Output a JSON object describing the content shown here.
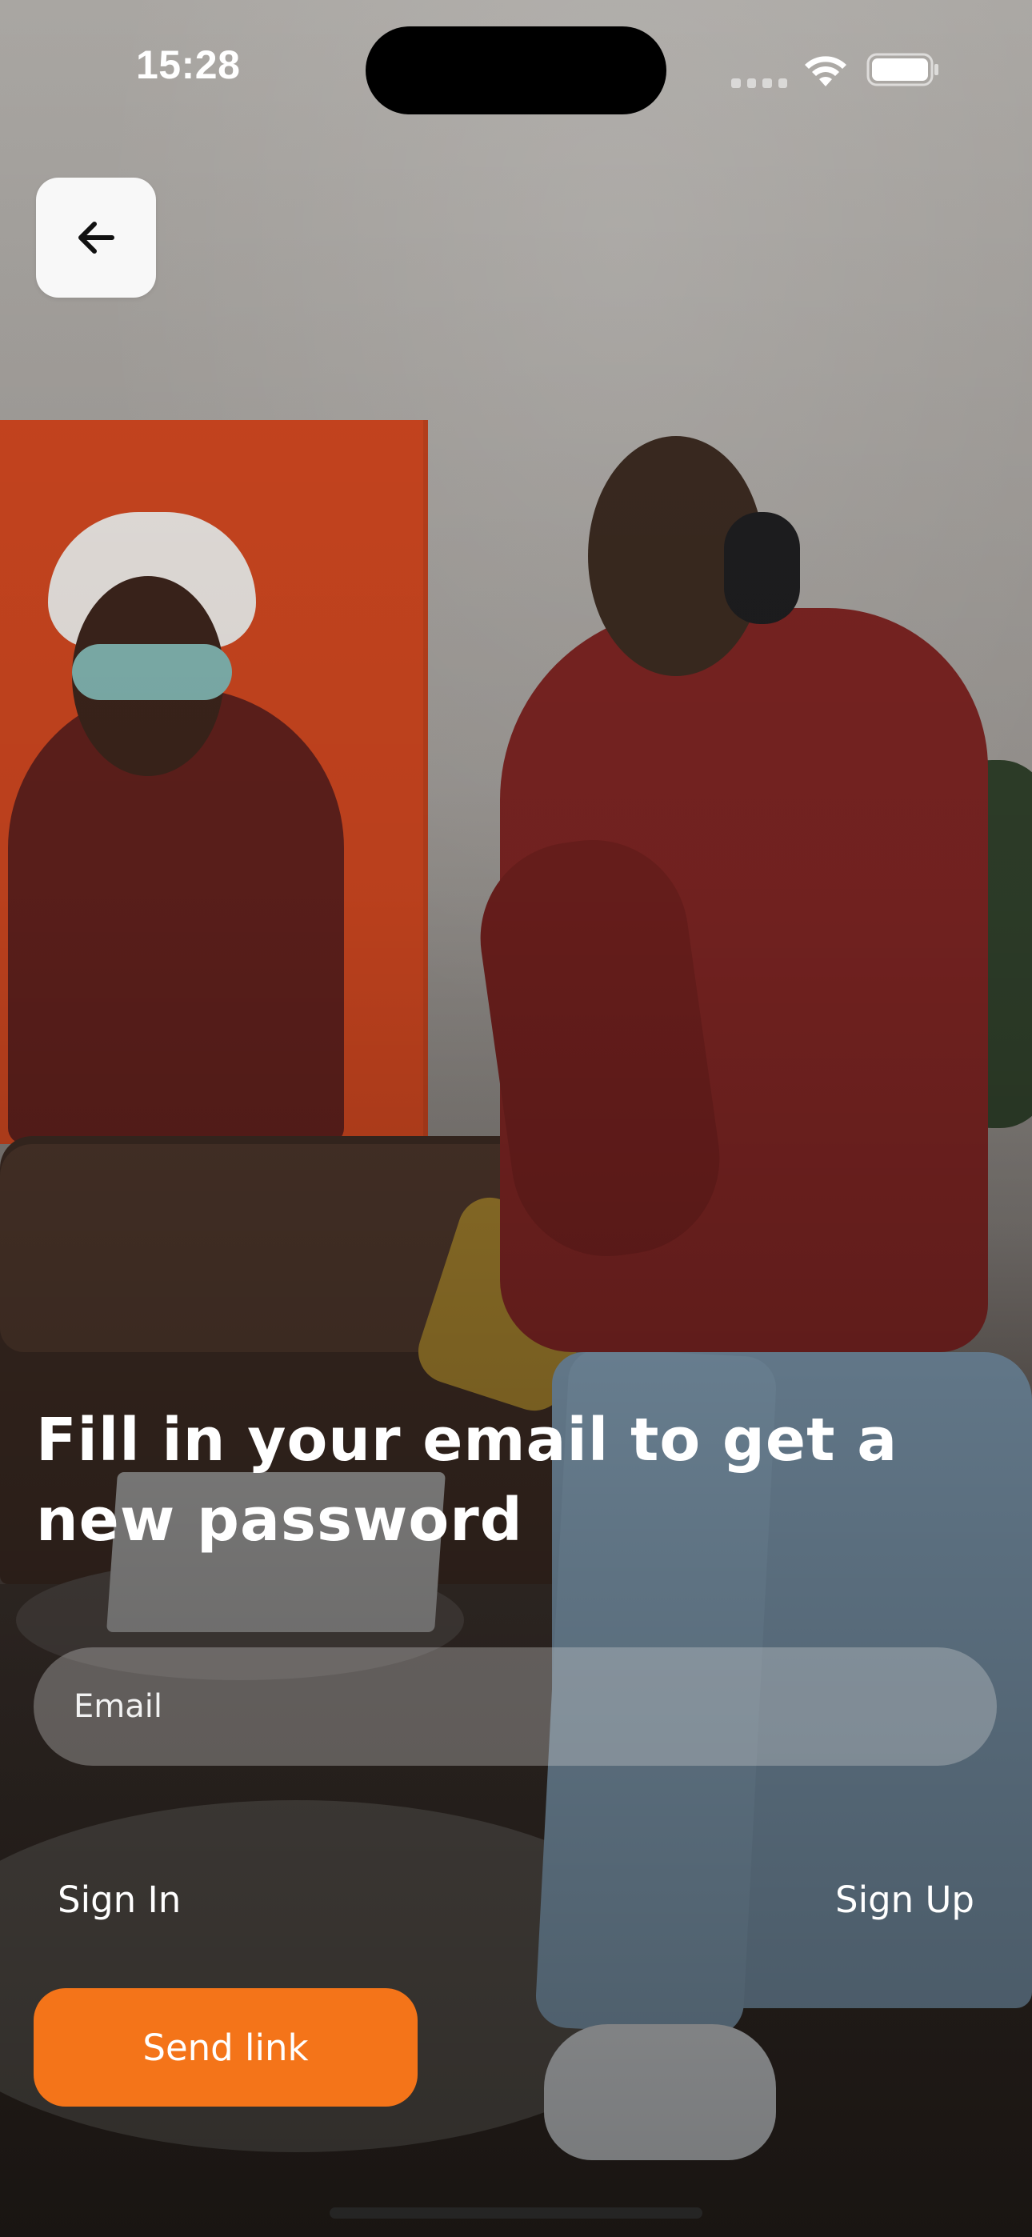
{
  "status_bar": {
    "time": "15:28"
  },
  "nav": {
    "back_icon": "arrow-left-icon"
  },
  "title": {
    "line1": "Fill in your email to get a",
    "line2": "new password"
  },
  "email": {
    "placeholder": "Email",
    "value": ""
  },
  "links": {
    "sign_in": "Sign In",
    "sign_up": "Sign Up"
  },
  "actions": {
    "send_link": "Send link"
  },
  "colors": {
    "accent": "#f47419",
    "text": "#ffffff",
    "back_button_bg": "#f8f8f8"
  }
}
